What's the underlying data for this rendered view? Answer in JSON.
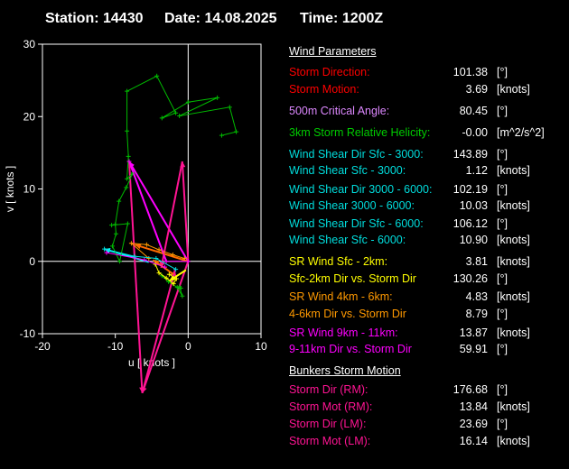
{
  "header": {
    "station": "Station: 14430",
    "date": "Date: 14.08.2025",
    "time": "Time: 1200Z"
  },
  "chart_data": {
    "type": "line",
    "xlabel": "u  [ knots ]",
    "ylabel": "v  [ knots ]",
    "xlim": [
      -20,
      10
    ],
    "ylim": [
      -10,
      30
    ],
    "xticks": [
      "-20",
      "-10",
      "0",
      "10"
    ],
    "yticks": [
      "-10",
      "0",
      "10",
      "20",
      "30"
    ],
    "grid": false,
    "series": [
      {
        "color": "#00bb00",
        "points": [
          [
            -10.5,
            5
          ],
          [
            -8.3,
            5.2
          ],
          [
            -9.4,
            0
          ],
          [
            -10.4,
            2.1
          ],
          [
            -9.9,
            3.8
          ],
          [
            -10,
            5.1
          ],
          [
            -9.5,
            8.3
          ],
          [
            -8.5,
            10.2
          ],
          [
            -7.6,
            12.2
          ],
          [
            -8.4,
            11.4
          ],
          [
            -8.2,
            14.5
          ],
          [
            -8.4,
            18
          ],
          [
            -8.4,
            23.5
          ],
          [
            -4.3,
            25.6
          ],
          [
            -1.7,
            20.5
          ],
          [
            -3.6,
            19.8
          ],
          [
            0,
            22
          ],
          [
            4,
            22.6
          ],
          [
            -1.2,
            20.1
          ],
          [
            5.7,
            21.3
          ],
          [
            6.6,
            17.9
          ],
          [
            4.6,
            17.4
          ]
        ]
      },
      {
        "color": "#00bb00",
        "points": [
          [
            -3.6,
            -2
          ],
          [
            -2.7,
            -2.8
          ],
          [
            -1.5,
            -3.6
          ],
          [
            -0.8,
            -4.8
          ],
          [
            -1.2,
            -3.5
          ],
          [
            -1,
            -3.7
          ]
        ]
      },
      {
        "color": "#ffff00",
        "points": [
          [
            -4.5,
            -0.4
          ],
          [
            -4.0,
            -1.6
          ],
          [
            -3.0,
            -2.3
          ],
          [
            -2.0,
            -3.1
          ],
          [
            -1.6,
            -2.4
          ],
          [
            -2.6,
            -1.8
          ]
        ]
      },
      {
        "color": "#ff9900",
        "points": [
          [
            -5.4,
            0.4
          ],
          [
            -7.8,
            2.5
          ],
          [
            -5.7,
            2.3
          ],
          [
            -4,
            1.6
          ],
          [
            -2.1,
            0.9
          ],
          [
            -0.5,
            0.4
          ]
        ]
      },
      {
        "color": "#00dddd",
        "points": [
          [
            -11.5,
            1.7
          ],
          [
            -7.4,
            0.7
          ],
          [
            -4.4,
            0.4
          ],
          [
            -1.7,
            -1.1
          ]
        ]
      },
      {
        "color": "#ff00ff",
        "points": [
          [
            -11.2,
            1.2
          ],
          [
            -6,
            0.2
          ],
          [
            -3.2,
            -0.8
          ]
        ]
      },
      {
        "color": "#ff00ff",
        "points": [
          [
            -8.1,
            13.8
          ],
          [
            -3,
            0
          ],
          [
            0,
            0
          ]
        ]
      }
    ],
    "vectors": [
      {
        "color": "#ff00ff",
        "from": [
          0,
          0
        ],
        "to": [
          -8.1,
          13.8
        ]
      },
      {
        "color": "#ff00ff",
        "from": [
          -3,
          0
        ],
        "to": [
          -8.1,
          13.8
        ]
      },
      {
        "color": "#ff1493",
        "from": [
          0,
          0
        ],
        "to": [
          -0.8,
          13.8
        ]
      },
      {
        "color": "#ff1493",
        "from": [
          0,
          0
        ],
        "to": [
          -6.3,
          -18.2
        ]
      },
      {
        "color": "#ff1493",
        "from": [
          -0.8,
          13.8
        ],
        "to": [
          -3.7,
          -0.9
        ]
      },
      {
        "color": "#ff1493",
        "from": [
          -6.3,
          -18.2
        ],
        "to": [
          -1.8,
          -1.2
        ]
      },
      {
        "color": "#ff1493",
        "from": [
          -8.1,
          13.8
        ],
        "to": [
          -6.3,
          -18.2
        ]
      },
      {
        "color": "#ff6a00",
        "from": [
          0,
          0
        ],
        "to": [
          -7.3,
          2.3
        ]
      },
      {
        "color": "#ff6a00",
        "from": [
          -2,
          -1.8
        ],
        "to": [
          -4.8,
          0.2
        ]
      },
      {
        "color": "#ffff00",
        "from": [
          -0.3,
          -1.2
        ],
        "to": [
          -2.6,
          -2.7
        ]
      },
      {
        "color": "#00ffff",
        "from": [
          -5.4,
          -0.1
        ],
        "to": [
          -11.5,
          1.7
        ]
      }
    ]
  },
  "panel": {
    "wind_title": "Wind Parameters",
    "bunkers_title": "Bunkers Storm Motion",
    "rows": [
      {
        "label": "Storm Direction:",
        "value": "101.38",
        "unit": "[°]",
        "color": "#ff0000"
      },
      {
        "label": "Storm Motion:",
        "value": "3.69",
        "unit": "[knots]",
        "color": "#ff0000"
      },
      {
        "label": "500m Critical Angle:",
        "value": "80.45",
        "unit": "[°]",
        "color": "#dd88ff"
      },
      {
        "label": "3km Storm Relative Helicity:",
        "value": "-0.00",
        "unit": "[m^2/s^2]",
        "color": "#00cc00"
      },
      {
        "label": "Wind Shear Dir Sfc - 3000:",
        "value": "143.89",
        "unit": "[°]",
        "color": "#00dddd"
      },
      {
        "label": "Wind Shear Sfc - 3000:",
        "value": "1.12",
        "unit": "[knots]",
        "color": "#00dddd"
      },
      {
        "label": "Wind Shear Dir 3000 - 6000:",
        "value": "102.19",
        "unit": "[°]",
        "color": "#00dddd"
      },
      {
        "label": "Wind Shear 3000 - 6000:",
        "value": "10.03",
        "unit": "[knots]",
        "color": "#00dddd"
      },
      {
        "label": "Wind Shear Dir Sfc - 6000:",
        "value": "106.12",
        "unit": "[°]",
        "color": "#00dddd"
      },
      {
        "label": "Wind Shear Sfc - 6000:",
        "value": "10.90",
        "unit": "[knots]",
        "color": "#00dddd"
      },
      {
        "label": "SR Wind Sfc - 2km:",
        "value": "3.81",
        "unit": "[knots]",
        "color": "#ffff00"
      },
      {
        "label": "Sfc-2km Dir vs. Storm Dir",
        "value": "130.26",
        "unit": "[°]",
        "color": "#ffff00"
      },
      {
        "label": "SR Wind 4km - 6km:",
        "value": "4.83",
        "unit": "[knots]",
        "color": "#ff9900"
      },
      {
        "label": "4-6km Dir vs. Storm Dir",
        "value": "8.79",
        "unit": "[°]",
        "color": "#ff9900"
      },
      {
        "label": "SR Wind 9km - 11km:",
        "value": "13.87",
        "unit": "[knots]",
        "color": "#ff00ff"
      },
      {
        "label": "9-11km Dir vs. Storm Dir",
        "value": "59.91",
        "unit": "[°]",
        "color": "#ff00ff"
      },
      {
        "label": "Storm Dir (RM):",
        "value": "176.68",
        "unit": "[°]",
        "color": "#ff1493"
      },
      {
        "label": "Storm Mot (RM):",
        "value": "13.84",
        "unit": "[knots]",
        "color": "#ff1493"
      },
      {
        "label": "Storm Dir (LM):",
        "value": "23.69",
        "unit": "[°]",
        "color": "#ff1493"
      },
      {
        "label": "Storm Mot (LM):",
        "value": "16.14",
        "unit": "[knots]",
        "color": "#ff1493"
      }
    ]
  }
}
